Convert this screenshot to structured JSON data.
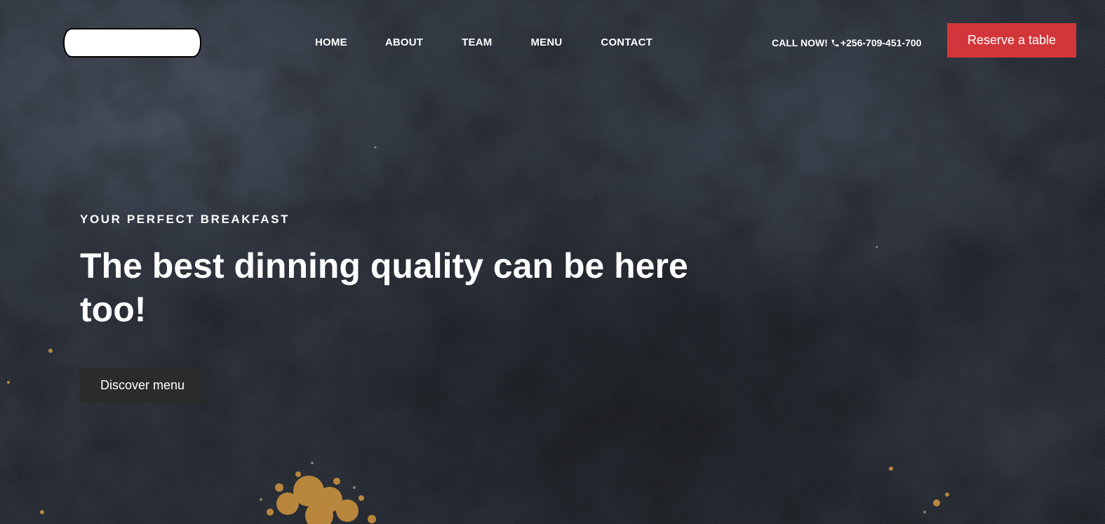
{
  "header": {
    "nav": [
      {
        "label": "HOME"
      },
      {
        "label": "ABOUT"
      },
      {
        "label": "TEAM"
      },
      {
        "label": "MENU"
      },
      {
        "label": "CONTACT"
      }
    ],
    "call_label": "CALL NOW!",
    "phone_icon": "phone-icon",
    "phone_number": "+256-709-451-700",
    "reserve_label": "Reserve a table"
  },
  "hero": {
    "eyebrow": "YOUR PERFECT BREAKFAST",
    "headline": "The best dinning quality can be here too!",
    "cta_label": "Discover menu"
  },
  "colors": {
    "accent": "#d3363a",
    "background": "#1c2029",
    "secondary_button": "#2b2b2b",
    "text": "#ffffff",
    "spice": "#c8903e"
  }
}
